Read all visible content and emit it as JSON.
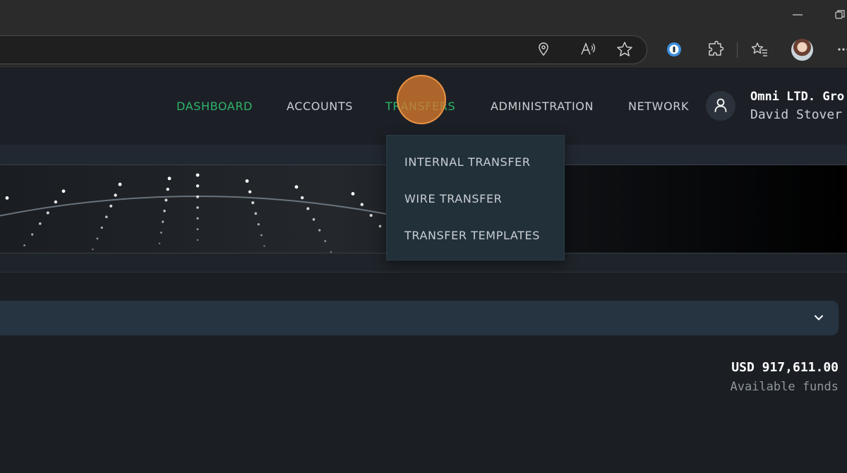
{
  "browser": {
    "icons": [
      "minimize-icon",
      "restore-icon",
      "location-icon",
      "read-aloud-icon",
      "favorite-star-icon",
      "password-manager-icon",
      "extensions-icon",
      "favorites-icon",
      "profile-avatar",
      "more-icon"
    ]
  },
  "nav": {
    "items": [
      {
        "label": "DASHBOARD",
        "active": true
      },
      {
        "label": "ACCOUNTS",
        "active": false
      },
      {
        "label": "TRANSFERS",
        "active": true
      },
      {
        "label": "ADMINISTRATION",
        "active": false
      },
      {
        "label": "NETWORK",
        "active": false
      }
    ]
  },
  "user": {
    "org": "Omni LTD. Gro",
    "name": "David Stover"
  },
  "transfers_menu": {
    "items": [
      "INTERNAL TRANSFER",
      "WIRE TRANSFER",
      "TRANSFER TEMPLATES"
    ]
  },
  "account": {
    "balance": "USD 917,611.00",
    "balance_label": "Available funds"
  },
  "colors": {
    "accent_green": "#2fb46a",
    "background": "#1b1f24",
    "dropdown": "#223039",
    "selector": "#263442",
    "click_indicator": "#d6782e"
  }
}
